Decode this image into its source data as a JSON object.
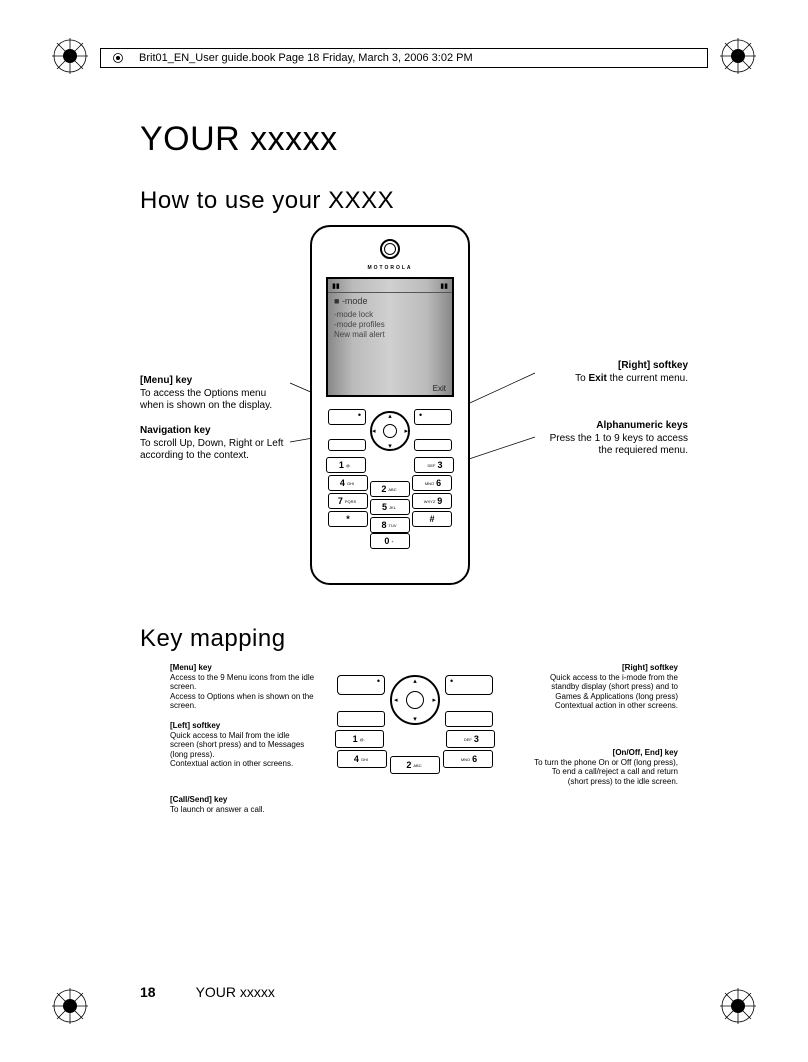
{
  "header": "Brit01_EN_User guide.book  Page 18  Friday, March 3, 2006  3:02 PM",
  "title": "YOUR xxxxx",
  "section1_title": "How to use your XXXX",
  "section2_title": "Key mapping",
  "phone": {
    "brand": "MOTOROLA",
    "screen_mode": "-mode",
    "screen_line1": "-mode lock",
    "screen_line2": "-mode profiles",
    "screen_line3": "New mail alert",
    "screen_exit": "Exit"
  },
  "keys": {
    "r1": [
      {
        "n": "1",
        "l": "@."
      },
      {
        "n": "3",
        "l": "DEF"
      }
    ],
    "r2": [
      {
        "n": "4",
        "l": "GHI"
      },
      {
        "n": "2",
        "l": "ABC"
      },
      {
        "n": "6",
        "l": "MNO"
      }
    ],
    "r3": [
      {
        "n": "7",
        "l": "PQRS"
      },
      {
        "n": "5",
        "l": "JKL"
      },
      {
        "n": "9",
        "l": "WXYZ"
      }
    ],
    "r4": [
      {
        "n": "*",
        "l": ""
      },
      {
        "n": "8",
        "l": "TUV"
      },
      {
        "n": "#",
        "l": ""
      }
    ],
    "r5": [
      {
        "n": "0",
        "l": "+"
      }
    ]
  },
  "callouts_main": {
    "menu": {
      "title": "[Menu] key",
      "text": "To access the Options menu when is shown on the display."
    },
    "nav": {
      "title": "Navigation key",
      "text": "To scroll Up, Down, Right or Left according to the context."
    },
    "right_soft": {
      "title": "[Right] softkey",
      "text_pre": "To ",
      "text_bold": "Exit",
      "text_post": " the current menu."
    },
    "alpha": {
      "title": "Alphanumeric keys",
      "text": "Press the 1 to 9 keys to access the requiered menu."
    }
  },
  "callouts_map": {
    "menu": {
      "title": "[Menu] key",
      "text": "Access to the 9 Menu icons from the idle screen.\nAccess to Options when is shown on the screen."
    },
    "left_soft": {
      "title": "[Left] softkey",
      "text": "Quick access to Mail from the idle screen (short press) and to Messages (long press).\nContextual action in other screens."
    },
    "call_send": {
      "title": "[Call/Send] key",
      "text": "To launch or answer a call."
    },
    "right_soft": {
      "title": "[Right] softkey",
      "text": "Quick access to the i-mode from the standby display (short press) and to Games & Applications (long press)\nContextual action in other screens."
    },
    "on_off": {
      "title": "[On/Off, End] key",
      "text": "To turn the phone On or Off (long press), To end a call/reject a call and return (short press) to the idle screen."
    }
  },
  "footer": {
    "page": "18",
    "title": "YOUR xxxxx"
  }
}
